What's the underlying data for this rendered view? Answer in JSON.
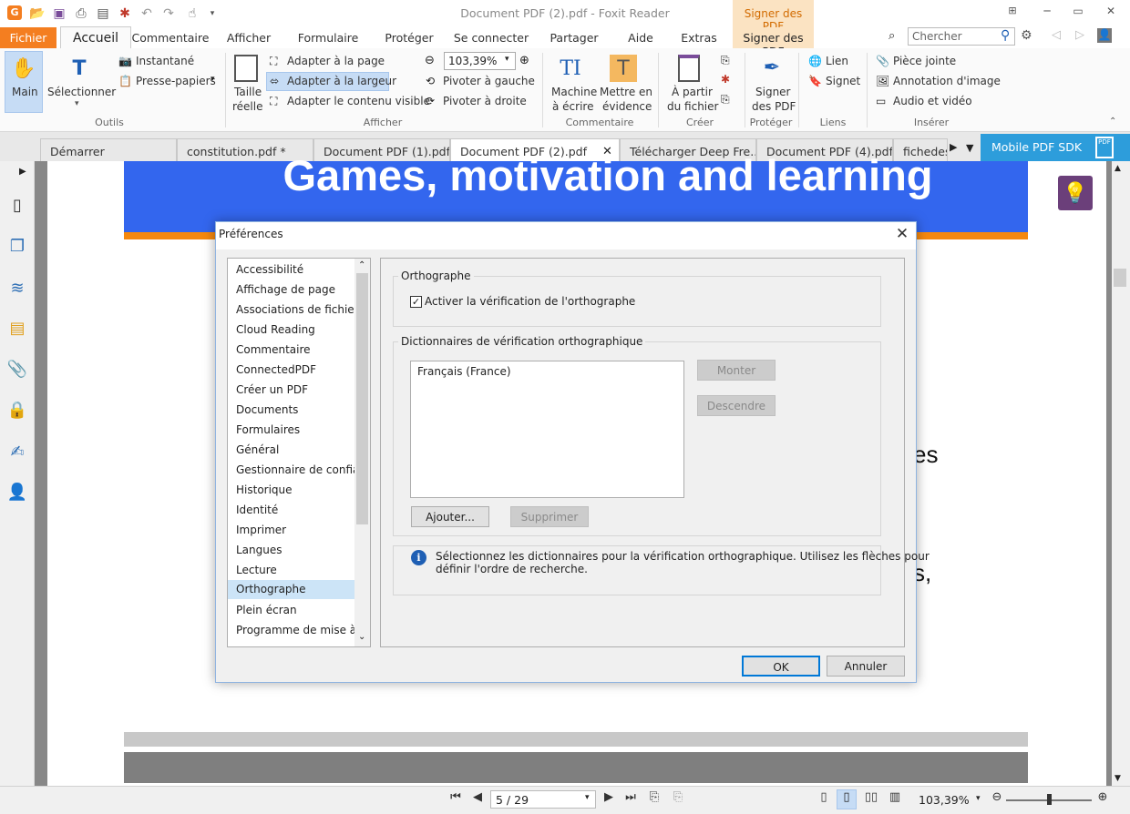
{
  "window": {
    "title": "Document PDF (2).pdf - Foxit Reader",
    "context_tab_header": "Signer des PDF"
  },
  "menu": {
    "tabs": [
      "Fichier",
      "Accueil",
      "Commentaire",
      "Afficher",
      "Formulaire",
      "Protéger",
      "Se connecter",
      "Partager",
      "Aide",
      "Extras",
      "Signer des PDF"
    ],
    "search_placeholder": "Chercher"
  },
  "ribbon": {
    "outils": {
      "main": "Main",
      "selectionner": "Sélectionner",
      "instantane": "Instantané",
      "presse_papiers": "Presse-papiers",
      "group": "Outils"
    },
    "afficher": {
      "taille1": "Taille",
      "taille2": "réelle",
      "adapter_page": "Adapter à la page",
      "adapter_largeur": "Adapter à la largeur",
      "adapter_contenu": "Adapter le contenu visible",
      "zoom": "103,39%",
      "pivoter_gauche": "Pivoter à gauche",
      "pivoter_droite": "Pivoter à droite",
      "group": "Afficher"
    },
    "commentaire": {
      "machine1": "Machine",
      "machine2": "à écrire",
      "mettre1": "Mettre en",
      "mettre2": "évidence",
      "group": "Commentaire"
    },
    "creer": {
      "apartir1": "À partir",
      "apartir2": "du fichier",
      "group": "Créer"
    },
    "proteger": {
      "signer1": "Signer",
      "signer2": "des PDF",
      "group": "Protéger"
    },
    "liens": {
      "lien": "Lien",
      "signet": "Signet",
      "group": "Liens"
    },
    "inserer": {
      "piece": "Pièce jointe",
      "annotation": "Annotation d'image",
      "audio": "Audio et vidéo",
      "group": "Insérer"
    }
  },
  "doc_tabs": [
    "Démarrer",
    "constitution.pdf *",
    "Document PDF (1).pdf",
    "Document PDF (2).pdf",
    "Télécharger Deep Fre...",
    "Document PDF (4).pdf",
    "fichedes"
  ],
  "mobile_sdk": "Mobile PDF SDK",
  "document": {
    "banner_title": "Games, motivation and learning",
    "fragment1": "es",
    "fragment2": "s,"
  },
  "status": {
    "page": "5 / 29",
    "zoom": "103,39%"
  },
  "dialog": {
    "title": "Préférences",
    "categories": [
      "Accessibilité",
      "Affichage de page",
      "Associations de fichiers",
      "Cloud Reading",
      "Commentaire",
      "ConnectedPDF",
      "Créer un PDF",
      "Documents",
      "Formulaires",
      "Général",
      "Gestionnaire de confiance",
      "Historique",
      "Identité",
      "Imprimer",
      "Langues",
      "Lecture",
      "Orthographe",
      "Plein écran",
      "Programme de mise à jour"
    ],
    "selected_category": "Orthographe",
    "group1_title": "Orthographe",
    "checkbox_label": "Activer la vérification de l'orthographe",
    "checkbox_checked": true,
    "group2_title": "Dictionnaires de vérification orthographique",
    "dictionaries": [
      "Français (France)"
    ],
    "monter": "Monter",
    "descendre": "Descendre",
    "ajouter": "Ajouter...",
    "supprimer": "Supprimer",
    "info_line1": "Sélectionnez les dictionnaires pour la vérification orthographique. Utilisez les flèches pour",
    "info_line2": "définir l'ordre de recherche.",
    "ok": "OK",
    "annuler": "Annuler"
  }
}
